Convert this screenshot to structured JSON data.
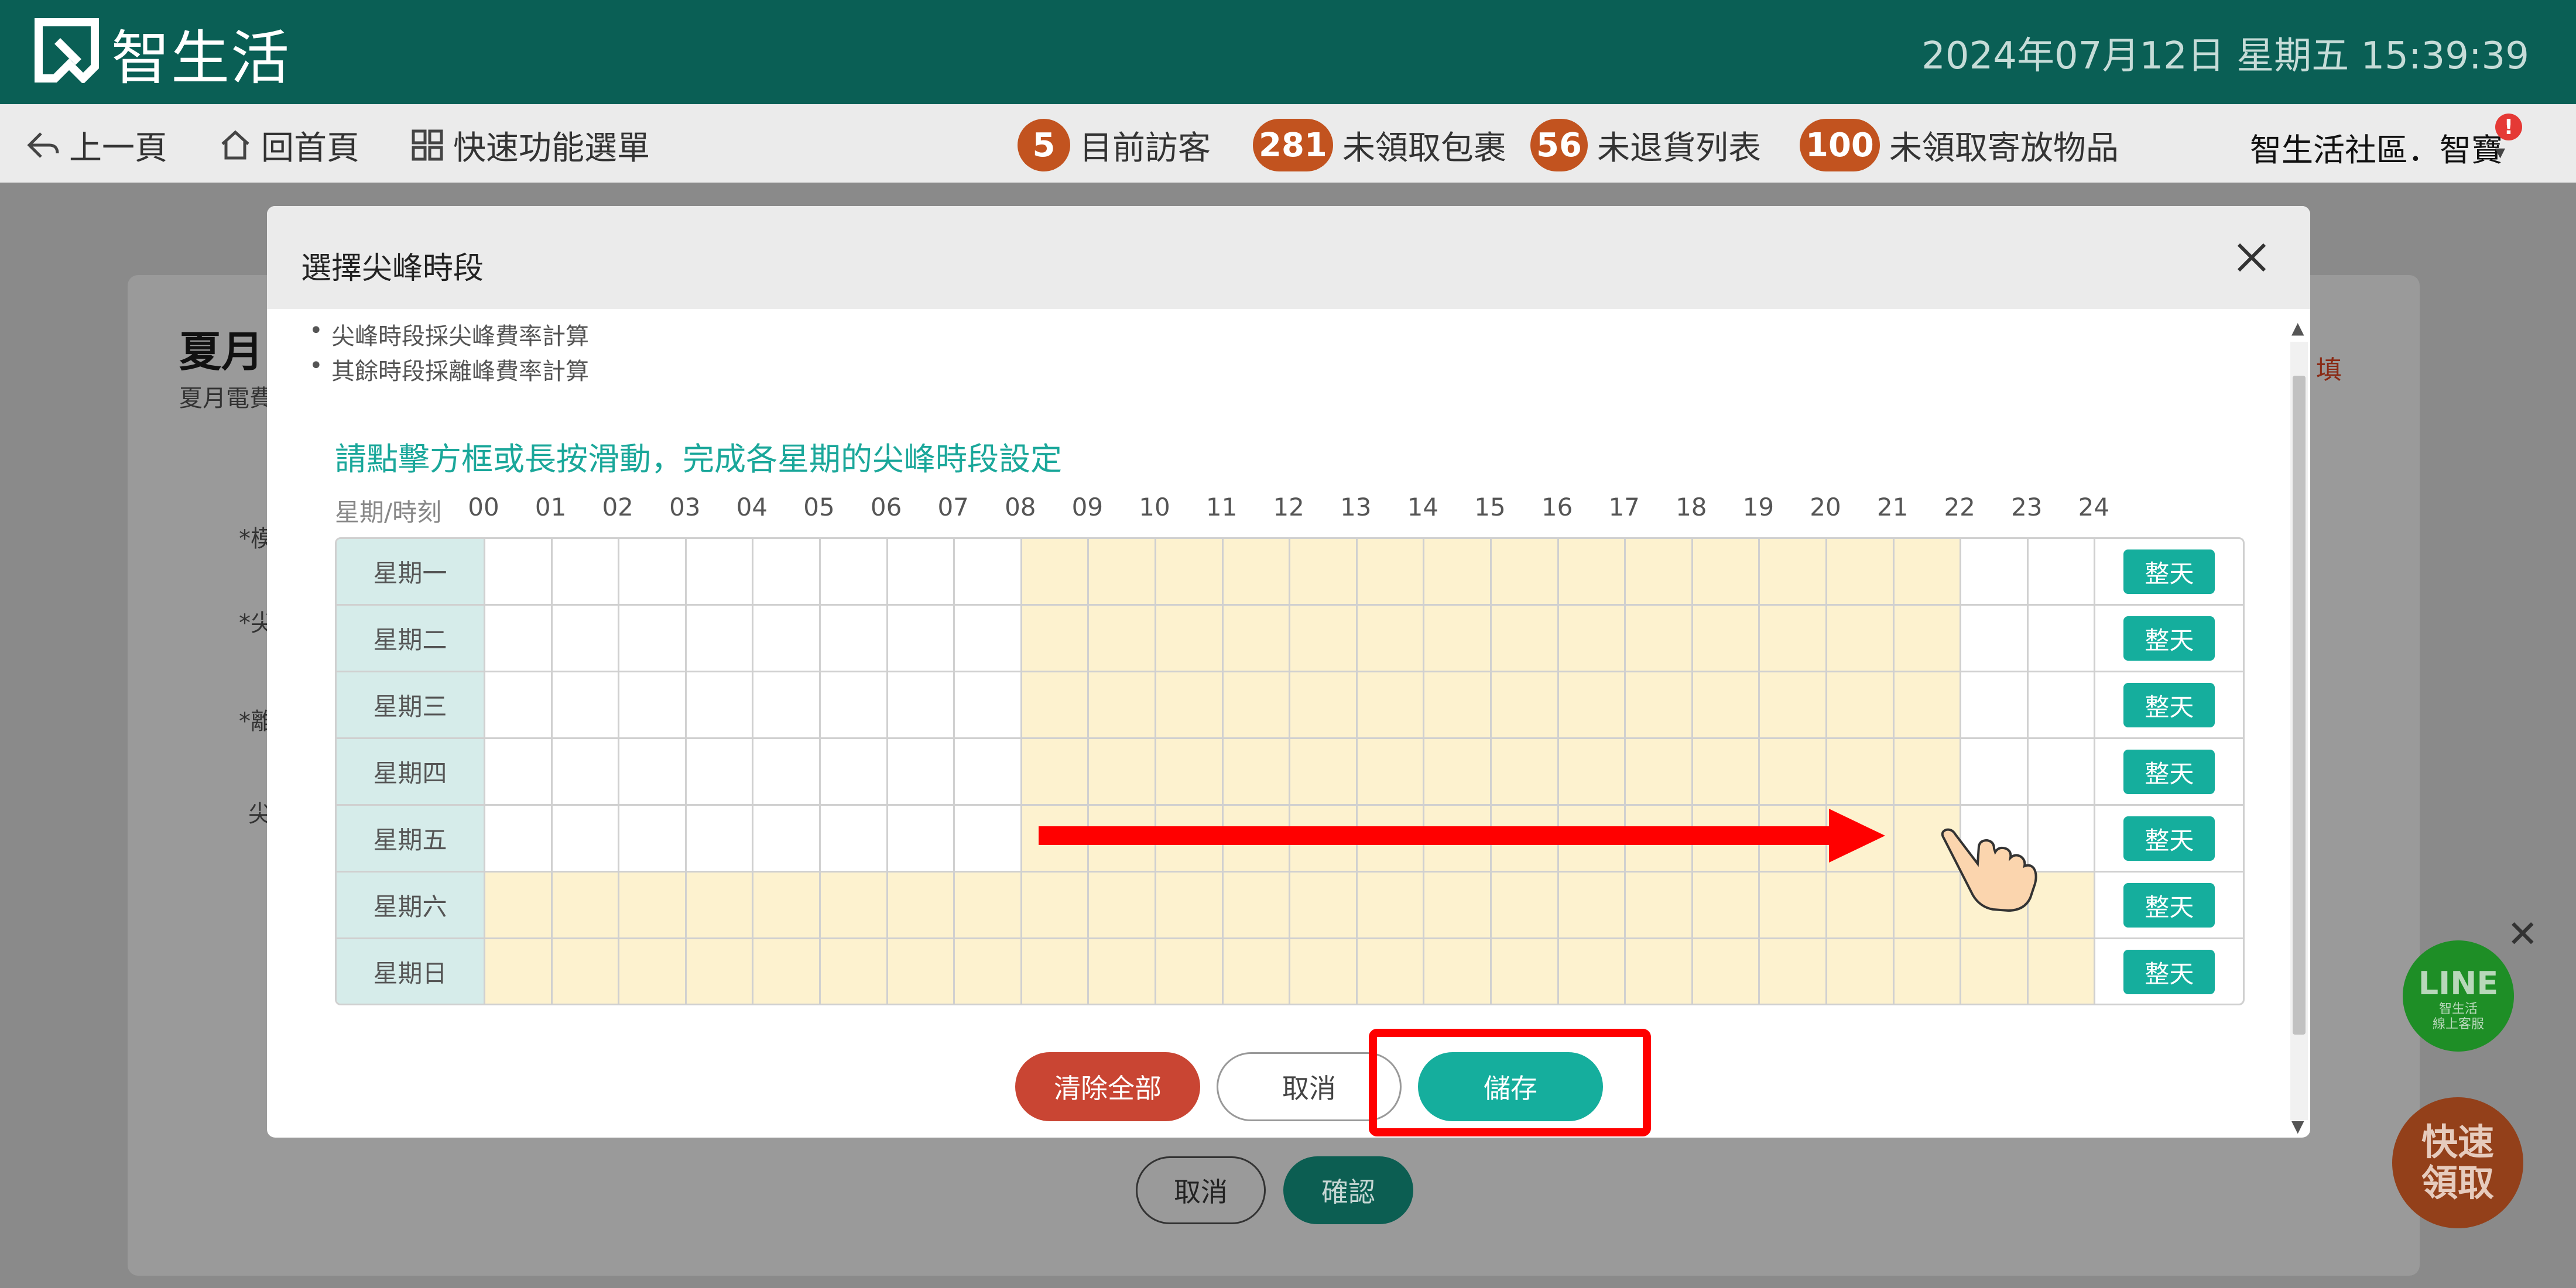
{
  "header": {
    "logo_text": "智生活",
    "datetime": "2024年07月12日 星期五 15:39:39"
  },
  "nav": {
    "prev": "上一頁",
    "home": "回首頁",
    "quick_menu": "快速功能選單",
    "visitors_count": "5",
    "visitors_label": "目前訪客",
    "packages_count": "281",
    "packages_label": "未領取包裹",
    "returns_count": "56",
    "returns_label": "未退貨列表",
    "deposits_count": "100",
    "deposits_label": "未領取寄放物品",
    "user": "智生活社區．智寶",
    "alert": "!"
  },
  "background_page": {
    "title": "夏月",
    "subtitle": "夏月電費",
    "labels": [
      "*模",
      "*尖",
      "*離",
      "尖"
    ],
    "fill_hint": "填",
    "cancel": "取消",
    "confirm": "確認"
  },
  "widgets": {
    "line_label": "LINE",
    "line_sub1": "智生活",
    "line_sub2": "線上客服",
    "quick_line1": "快速",
    "quick_line2": "領取"
  },
  "modal": {
    "title": "選擇尖峰時段",
    "notes": [
      "尖峰時段採尖峰費率計算",
      "其餘時段採離峰費率計算"
    ],
    "instruction": "請點擊方框或長按滑動，完成各星期的尖峰時段設定",
    "grid_header_label": "星期/時刻",
    "hours": [
      "00",
      "01",
      "02",
      "03",
      "04",
      "05",
      "06",
      "07",
      "08",
      "09",
      "10",
      "11",
      "12",
      "13",
      "14",
      "15",
      "16",
      "17",
      "18",
      "19",
      "20",
      "21",
      "22",
      "23",
      "24"
    ],
    "full_day_label": "整天",
    "days": [
      {
        "name": "星期一",
        "peak_start": 8,
        "peak_end": 22
      },
      {
        "name": "星期二",
        "peak_start": 8,
        "peak_end": 22
      },
      {
        "name": "星期三",
        "peak_start": 8,
        "peak_end": 22
      },
      {
        "name": "星期四",
        "peak_start": 8,
        "peak_end": 22
      },
      {
        "name": "星期五",
        "peak_start": 8,
        "peak_end": 22
      },
      {
        "name": "星期六",
        "peak_start": 0,
        "peak_end": 24
      },
      {
        "name": "星期日",
        "peak_start": 0,
        "peak_end": 24
      }
    ],
    "buttons": {
      "clear_all": "清除全部",
      "cancel": "取消",
      "save": "儲存"
    }
  },
  "colors": {
    "header_bg": "#0a5f55",
    "peak_cell": "#fdf2cf",
    "accent": "#15ae9d",
    "danger": "#c94533",
    "badge": "#c2531f",
    "annotation": "#ff0000"
  }
}
